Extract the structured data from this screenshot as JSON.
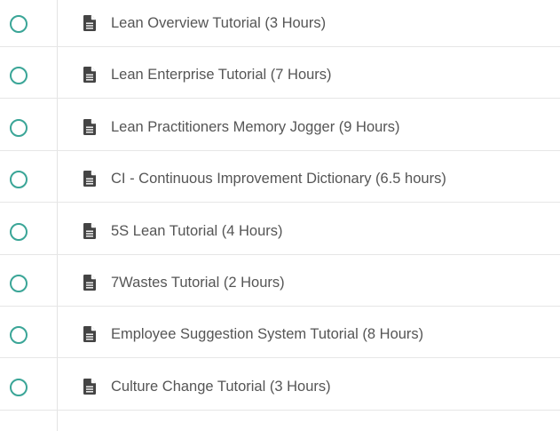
{
  "lessons": [
    {
      "title": "Lean Overview Tutorial (3 Hours)",
      "status_icon": "circle-outline-icon",
      "type_icon": "document-icon"
    },
    {
      "title": "Lean Enterprise Tutorial (7 Hours)",
      "status_icon": "circle-outline-icon",
      "type_icon": "document-icon"
    },
    {
      "title": "Lean Practitioners Memory Jogger (9 Hours)",
      "status_icon": "circle-outline-icon",
      "type_icon": "document-icon"
    },
    {
      "title": "CI - Continuous Improvement Dictionary (6.5 hours)",
      "status_icon": "circle-outline-icon",
      "type_icon": "document-icon"
    },
    {
      "title": "5S Lean Tutorial (4 Hours)",
      "status_icon": "circle-outline-icon",
      "type_icon": "document-icon"
    },
    {
      "title": "7Wastes Tutorial (2 Hours)",
      "status_icon": "circle-outline-icon",
      "type_icon": "document-icon"
    },
    {
      "title": "Employee Suggestion System Tutorial (8 Hours)",
      "status_icon": "circle-outline-icon",
      "type_icon": "document-icon"
    },
    {
      "title": "Culture Change Tutorial (3 Hours)",
      "status_icon": "circle-outline-icon",
      "type_icon": "document-icon"
    }
  ],
  "colors": {
    "status_circle": "#3aa597",
    "icon": "#444444",
    "text": "#555555",
    "divider": "#e6e6e6"
  }
}
